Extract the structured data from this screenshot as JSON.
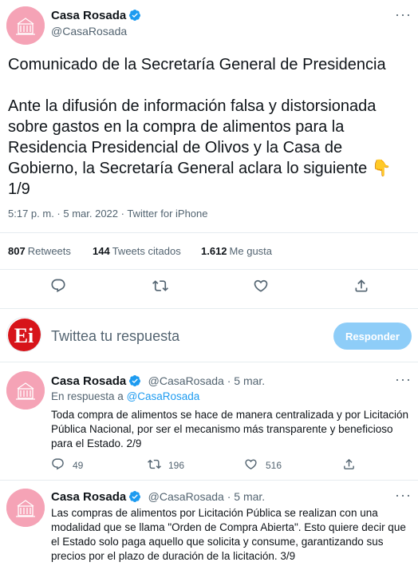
{
  "main_tweet": {
    "author_name": "Casa Rosada",
    "author_handle": "@CasaRosada",
    "text_line1": "Comunicado de la Secretaría General de Presidencia",
    "text_p2_line1": "Ante la difusión de información falsa y distorsionada",
    "text_p2_line2": "sobre gastos en la compra de alimentos para la",
    "text_p2_line3": "Residencia Presidencial de Olivos y la Casa de",
    "text_p2_line4": "Gobierno, la Secretaría General aclara lo siguiente",
    "emoji": "👇",
    "text_p2_line5": "1/9",
    "timestamp": "5:17 p. m. · 5 mar. 2022 · Twitter for iPhone",
    "retweets_count": "807",
    "retweets_label": "Retweets",
    "quotes_count": "144",
    "quotes_label": "Tweets citados",
    "likes_count": "1.612",
    "likes_label": "Me gusta"
  },
  "compose": {
    "placeholder": "Twittea tu respuesta",
    "button_label": "Responder",
    "avatar_text": "Ei"
  },
  "replies": [
    {
      "author_name": "Casa Rosada",
      "author_handle": "@CasaRosada · 5 mar.",
      "in_reply_prefix": "En respuesta a ",
      "in_reply_handle": "@CasaRosada",
      "line1": "Toda compra de alimentos se hace de manera centralizada y por Licitación",
      "line2": "Pública Nacional, por ser el mecanismo más transparente y beneficioso",
      "line3": "para el Estado. 2/9",
      "replies_count": "49",
      "retweets_count": "196",
      "likes_count": "516"
    },
    {
      "author_name": "Casa Rosada",
      "author_handle": "@CasaRosada · 5 mar.",
      "line1": "Las compras de alimentos por Licitación Pública se realizan con una",
      "line2": "modalidad que se llama \"Orden de Compra Abierta\". Esto quiere decir que",
      "line3": "el Estado solo paga aquello que solicita y consume, garantizando sus",
      "line4": "precios por el plazo de duración de la licitación. 3/9"
    }
  ],
  "colors": {
    "accent": "#1d9bf0",
    "avatar_pink": "#f5a3b6",
    "emoji_yellow": "#ffcc4d",
    "reply_button": "#8ecdf8",
    "ei_red": "#d7141a"
  }
}
